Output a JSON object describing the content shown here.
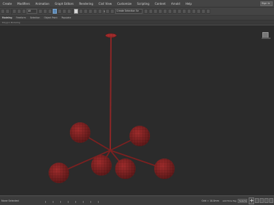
{
  "menubar": {
    "items": [
      "Create",
      "Modifiers",
      "Animation",
      "Graph Editors",
      "Rendering",
      "Civil View",
      "Customize",
      "Scripting",
      "Content",
      "Arnold",
      "Help"
    ],
    "search_label": "Sign in"
  },
  "toolbar": {
    "selection_filter": "All",
    "angle_value": "3",
    "named_selection": "Create Selection Se"
  },
  "ribbon": {
    "tabs": [
      "Modeling",
      "Freeform",
      "Selection",
      "Object Paint",
      "Populate"
    ]
  },
  "subribbon": {
    "items": [
      "Polygon Modeling"
    ]
  },
  "statusbar": {
    "script_label": "None Selected",
    "grid": "Grid = 10.0mm",
    "add_time_tag": "Add Time Tag",
    "key_filter": "Selected"
  },
  "colors": {
    "model_red": "#9b2a2a",
    "viewport_bg": "#2b2b2b",
    "ui_bg": "#444444"
  }
}
